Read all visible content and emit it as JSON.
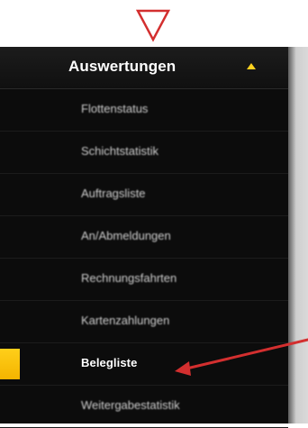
{
  "menu": {
    "title": "Auswertungen",
    "items": [
      {
        "label": "Flottenstatus"
      },
      {
        "label": "Schichtstatistik"
      },
      {
        "label": "Auftragsliste"
      },
      {
        "label": "An/Abmeldungen"
      },
      {
        "label": "Rechnungsfahrten"
      },
      {
        "label": "Kartenzahlungen"
      },
      {
        "label": "Belegliste",
        "active": true
      },
      {
        "label": "Weitergabestatistik"
      }
    ]
  },
  "colors": {
    "accent": "#ffd21f",
    "annotation": "#d32f2f",
    "panel_bg": "#0c0c0c"
  },
  "icons": {
    "header": "caret-up-icon",
    "marker": "down-triangle-marker",
    "callout": "red-arrow-annotation"
  }
}
